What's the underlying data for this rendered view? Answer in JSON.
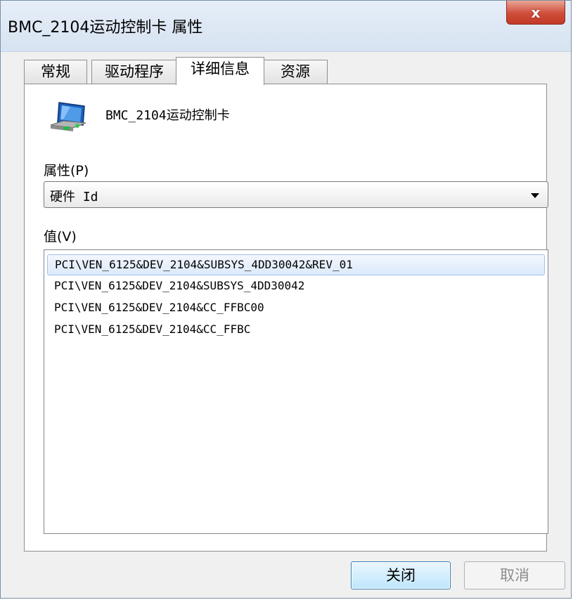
{
  "window": {
    "title": "BMC_2104运动控制卡 属性",
    "close_glyph": "x"
  },
  "tabs": [
    {
      "label": "常规"
    },
    {
      "label": "驱动程序"
    },
    {
      "label": "详细信息",
      "active": true
    },
    {
      "label": "资源"
    }
  ],
  "device": {
    "icon": "network-card-icon",
    "name": "BMC_2104运动控制卡"
  },
  "property": {
    "label": "属性(P)",
    "selected": "硬件 Id"
  },
  "value": {
    "label": "值(V)",
    "items": [
      "PCI\\VEN_6125&DEV_2104&SUBSYS_4DD30042&REV_01",
      "PCI\\VEN_6125&DEV_2104&SUBSYS_4DD30042",
      "PCI\\VEN_6125&DEV_2104&CC_FFBC00",
      "PCI\\VEN_6125&DEV_2104&CC_FFBC"
    ],
    "selected_index": 0
  },
  "buttons": {
    "close": "关闭",
    "cancel": "取消"
  },
  "colors": {
    "selection": "#dceafc",
    "close_red": "#cf4d3a"
  }
}
